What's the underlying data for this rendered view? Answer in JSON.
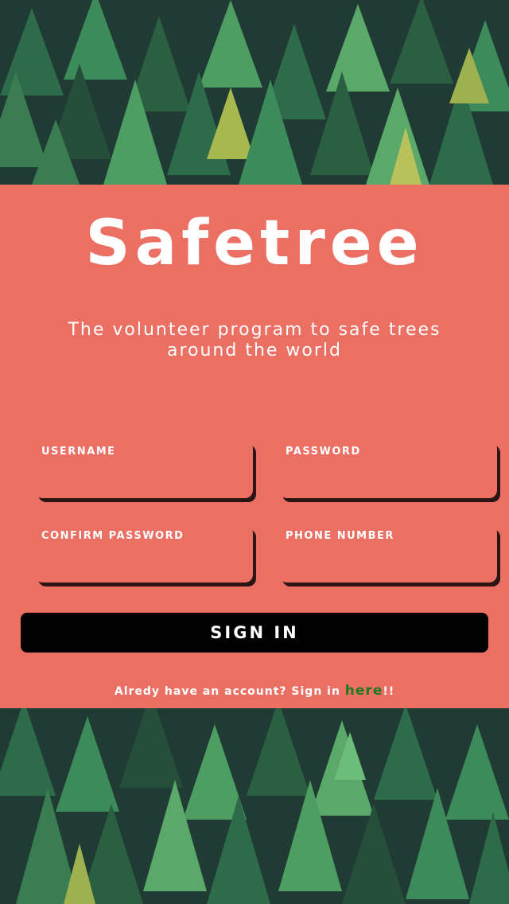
{
  "app": {
    "title": "Safetree",
    "tagline": "The volunteer program to safe trees around the world"
  },
  "form": {
    "fields": [
      {
        "label": "USERNAME",
        "value": ""
      },
      {
        "label": "PASSWORD",
        "value": ""
      },
      {
        "label": "CONFIRM PASSWORD",
        "value": ""
      },
      {
        "label": "PHONE NUMBER",
        "value": ""
      }
    ],
    "submit_label": "SIGN IN"
  },
  "footer": {
    "prompt": "Alredy have an account? Sign in ",
    "link_label": "here",
    "suffix": "!!"
  },
  "colors": {
    "panel": "#ec6f64",
    "button": "#000000",
    "link": "#1e7a1e",
    "forest_dark": "#1f3b33",
    "forest_light": "#3d8a5a"
  }
}
